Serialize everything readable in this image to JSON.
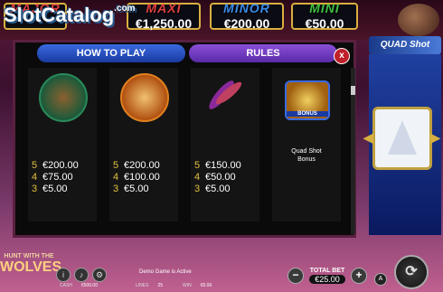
{
  "watermark": {
    "text": "SlotCatalog",
    "suffix": ".com"
  },
  "jackpots": [
    {
      "name": "MAJOR",
      "value": "",
      "color": "#e04040"
    },
    {
      "name": "MAXI",
      "value": "€1,250.00",
      "color": "#e04040"
    },
    {
      "name": "MINOR",
      "value": "€200.00",
      "color": "#3a8ae8"
    },
    {
      "name": "MINI",
      "value": "€50.00",
      "color": "#40c040"
    }
  ],
  "game_logo": {
    "top": "HUNT WITH THE",
    "main": "WOLVES"
  },
  "reel_logo": "QUAD Shot",
  "paytable": {
    "tabs": [
      {
        "label": "HOW TO PLAY"
      },
      {
        "label": "RULES"
      }
    ],
    "close_label": "x",
    "symbols": [
      {
        "icon": "lynx-icon",
        "pays": [
          {
            "count": "5",
            "amount": "€200.00"
          },
          {
            "count": "4",
            "amount": "€75.00"
          },
          {
            "count": "3",
            "amount": "€5.00"
          }
        ]
      },
      {
        "icon": "eagle-icon",
        "pays": [
          {
            "count": "5",
            "amount": "€200.00"
          },
          {
            "count": "4",
            "amount": "€100.00"
          },
          {
            "count": "3",
            "amount": "€5.00"
          }
        ]
      },
      {
        "icon": "feathers-icon",
        "pays": [
          {
            "count": "5",
            "amount": "€150.00"
          },
          {
            "count": "4",
            "amount": "€50.00"
          },
          {
            "count": "3",
            "amount": "€5.00"
          }
        ]
      },
      {
        "icon": "quad-shot-bonus-icon",
        "badge": "BONUS",
        "label_line1": "Quad Shot",
        "label_line2": "Bonus"
      }
    ]
  },
  "bottom_bar": {
    "status": "Demo Game is Active",
    "cash_label": "CASH",
    "cash_value": "€500.00",
    "lines_label": "LINES",
    "lines_value": "25",
    "win_label": "WIN",
    "win_value": "€0.00",
    "total_bet_label": "TOTAL BET",
    "total_bet_value": "€25.00",
    "minus_label": "−",
    "plus_label": "+",
    "info_label": "i",
    "auto_label": "A"
  }
}
